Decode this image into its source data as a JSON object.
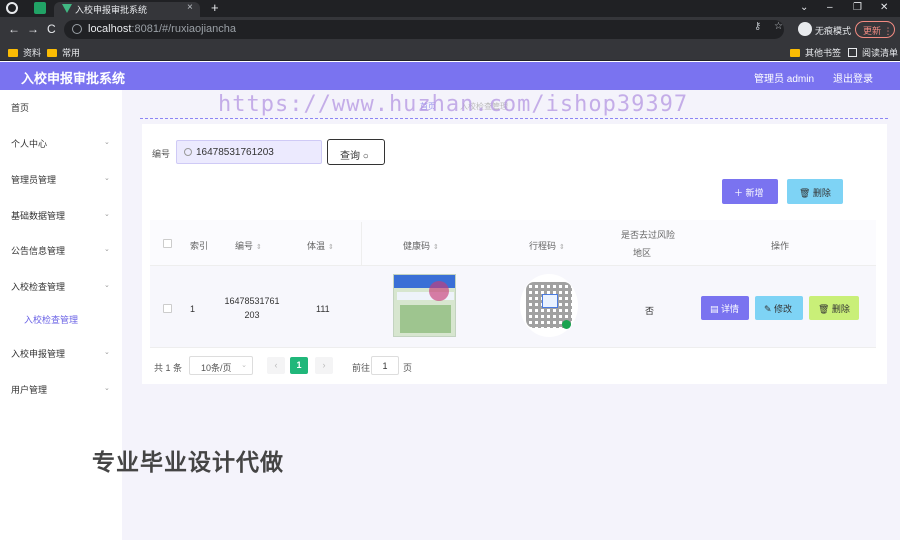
{
  "browser": {
    "tab_title": "入校申报审批系统",
    "tab_close": "×",
    "new_tab": "+",
    "window_controls": [
      "⌄",
      "–",
      "❐",
      "✕"
    ],
    "nav": {
      "back": "←",
      "forward": "→",
      "reload": "C"
    },
    "url_host": "localhost",
    "url_path": ":8081/#/ruxiaojiancha",
    "url_icons": [
      "key-icon",
      "star-icon"
    ],
    "url_key": "⚷",
    "url_star": "☆",
    "incognito_label": "无痕模式",
    "update_label": "更新",
    "update_menu": "⋮",
    "bookmarks": [
      {
        "label": "资料"
      },
      {
        "label": "常用"
      }
    ],
    "bookmarks_right": [
      {
        "label": "其他书签"
      },
      {
        "label": "阅读清单"
      }
    ]
  },
  "header": {
    "title": "入校申报审批系统",
    "user": "管理员 admin",
    "logout": "退出登录",
    "color": "#7a73f0"
  },
  "sidebar": {
    "items": [
      {
        "label": "首页"
      },
      {
        "label": "个人中心"
      },
      {
        "label": "管理员管理"
      },
      {
        "label": "基础数据管理"
      },
      {
        "label": "公告信息管理"
      },
      {
        "label": "入校检查管理"
      },
      {
        "label": "入校申报管理"
      },
      {
        "label": "用户管理"
      }
    ],
    "active_sub": "入校检查管理",
    "caret": "⌄"
  },
  "watermark": "https://www.huzhan.com/ishop39397",
  "breadcrumb": {
    "link": "首页",
    "current": "入校检查管理"
  },
  "search": {
    "label": "编号",
    "value": "16478531761203",
    "button": "查询",
    "button_icon": "search-icon"
  },
  "actions": {
    "add": "＋ 新增",
    "delete": "🗑 删除"
  },
  "table": {
    "headers": {
      "index": "索引",
      "no": "编号",
      "temp": "体温",
      "health_code": "健康码",
      "trip_code": "行程码",
      "risk_line1": "是否去过风险",
      "risk_line2": "地区",
      "ops": "操作"
    },
    "sort_glyph": "⇕",
    "rows": [
      {
        "index": "1",
        "no_line1": "16478531761",
        "no_line2": "203",
        "temp": "111",
        "risk": "否",
        "detail": "▤ 详情",
        "edit": "✎ 修改",
        "del": "🗑 删除"
      }
    ]
  },
  "pagination": {
    "total": "共 1 条",
    "page_size": "10条/页",
    "current": "1",
    "goto_label": "前往",
    "goto_value": "1",
    "page_suffix": "页",
    "prev": "‹",
    "next": "›",
    "caret": "⌄"
  },
  "promo_text": "专业毕业设计代做",
  "colors": {
    "primary": "#7a73f0",
    "info": "#7ed3f5",
    "lime": "#c9ef78",
    "page_active": "#20b77a"
  }
}
